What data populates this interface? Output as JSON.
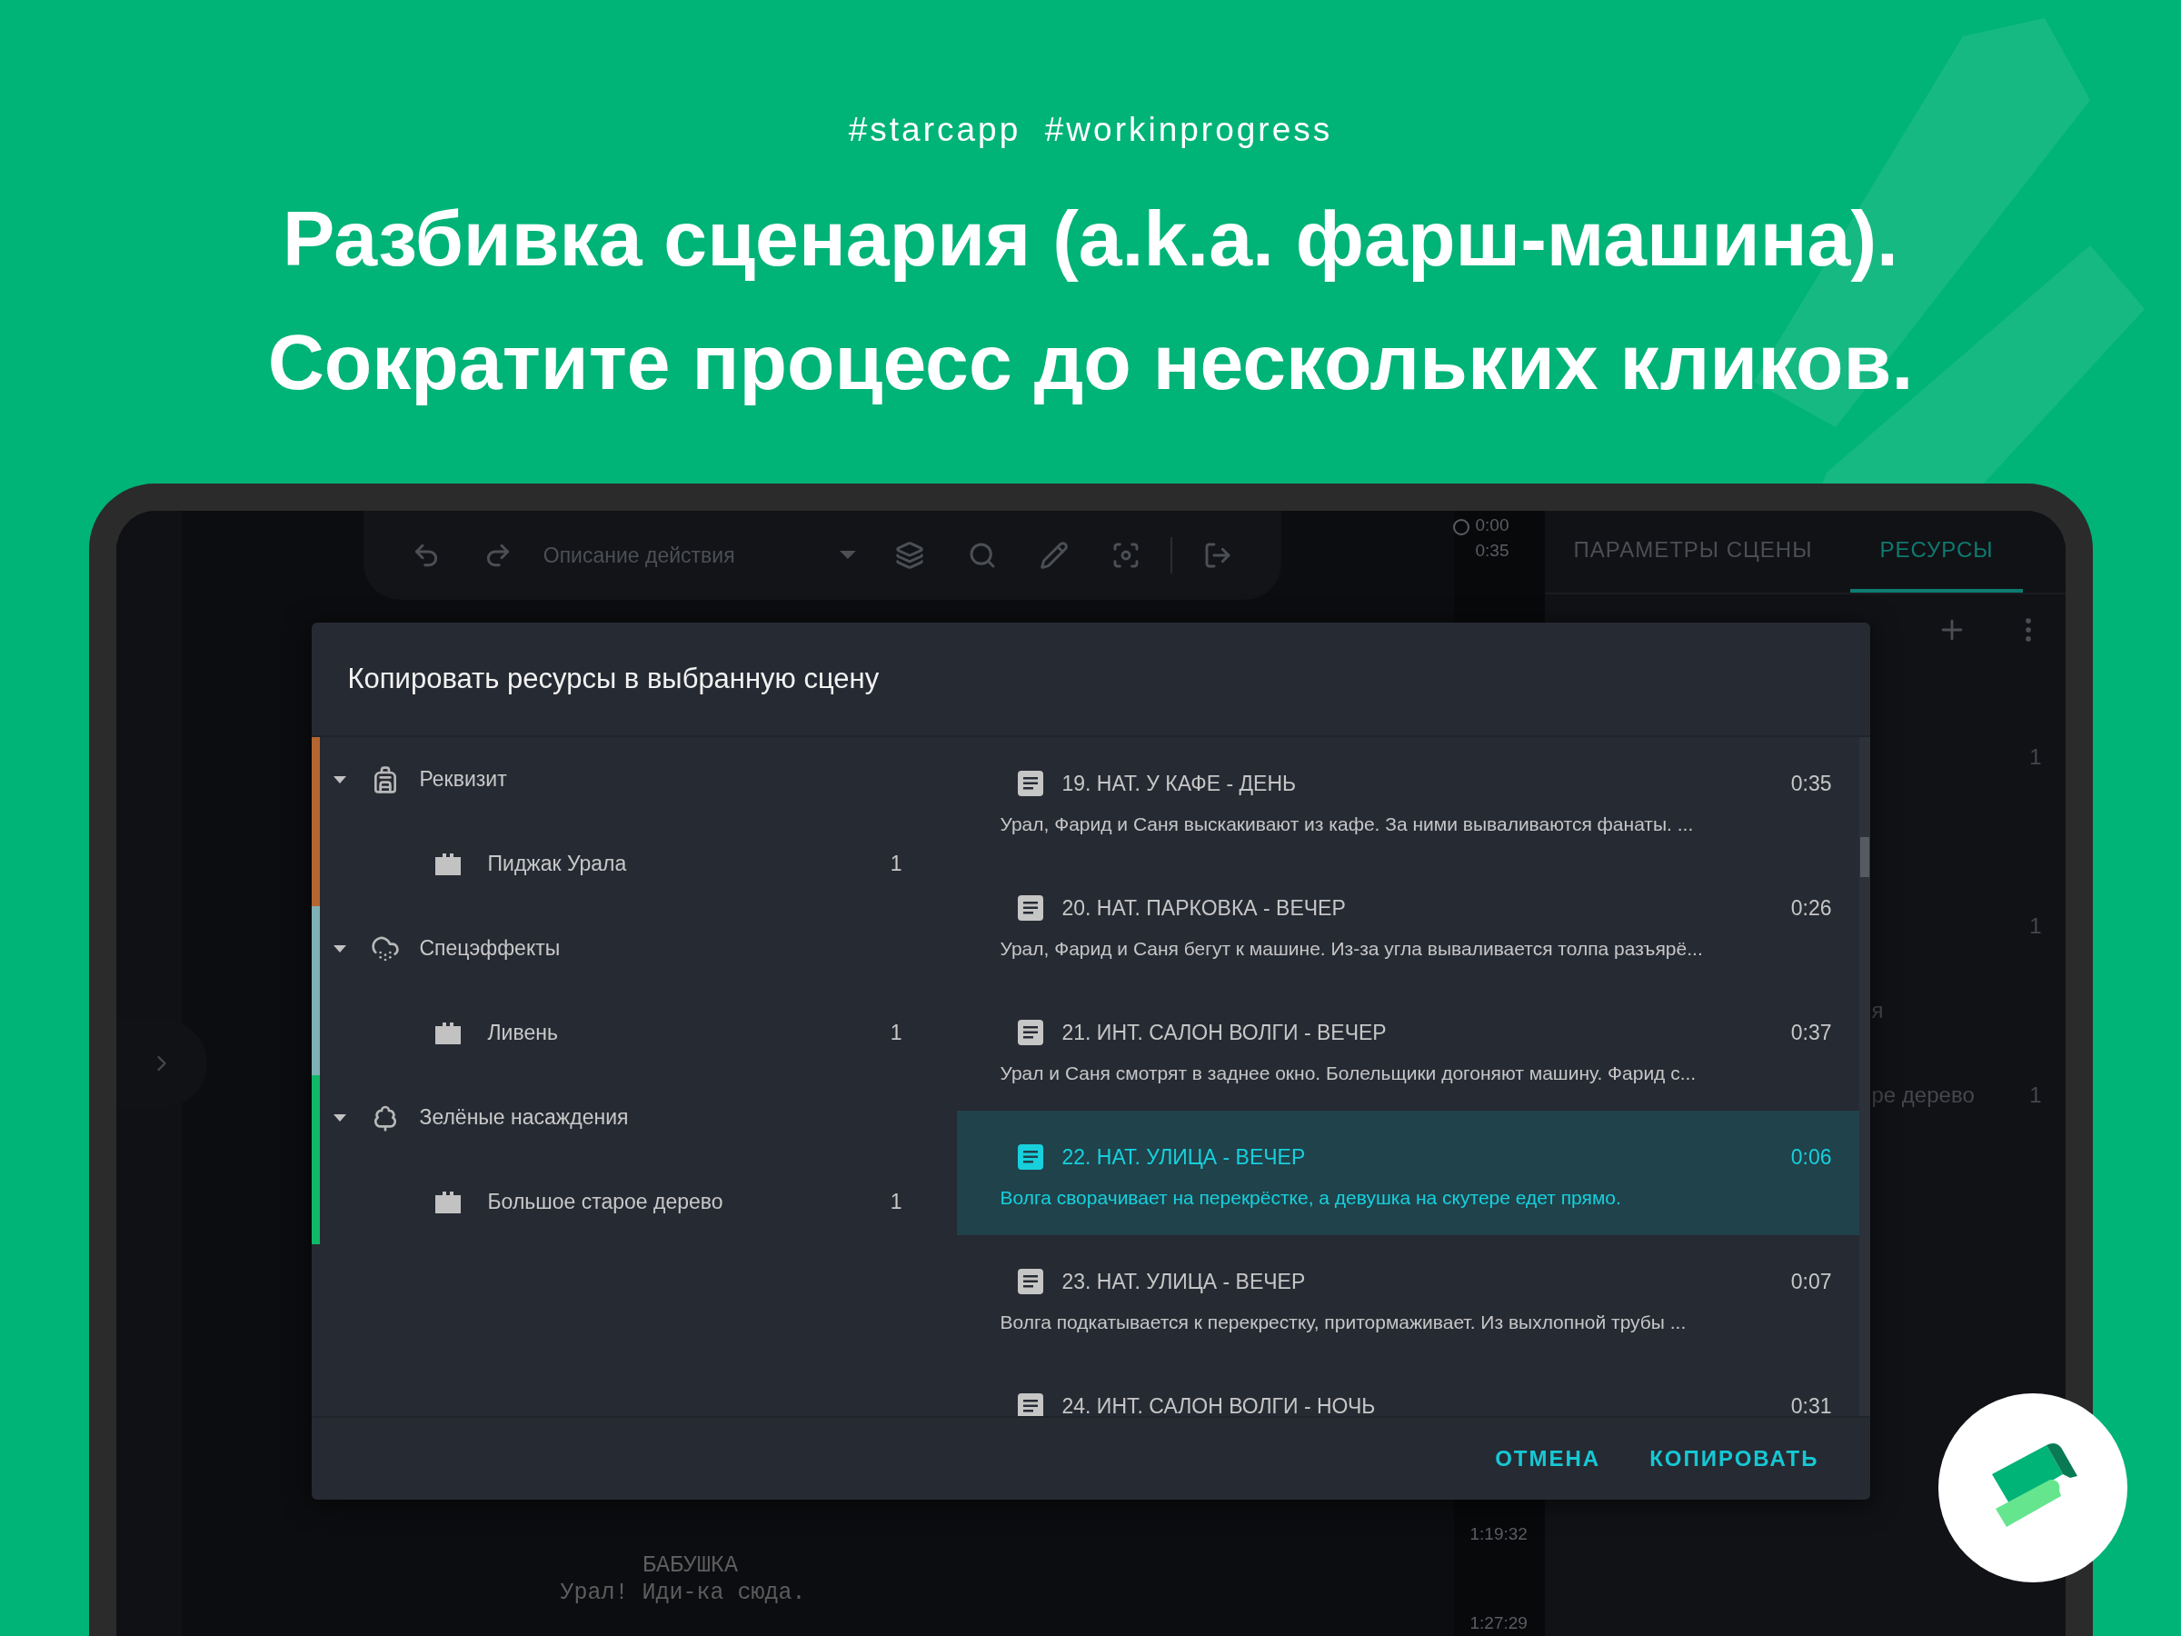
{
  "header": {
    "tags": "#starcapp  #workinprogress",
    "headline": [
      "Разбивка сценария (a.k.a. фарш-машина).",
      "Сократите процесс до нескольких кликов."
    ]
  },
  "editor": {
    "toolbar": {
      "block_type": "Описание действия"
    },
    "screenplay": [
      {
        "kind": "character",
        "text": "БАБУШКА"
      },
      {
        "kind": "dialogue",
        "text": "Урал! Иди-ка сюда."
      }
    ]
  },
  "timeline": {
    "top": [
      "0:00",
      "0:35"
    ],
    "bottom": [
      "1:19:32",
      "1:27:29"
    ]
  },
  "resources_panel": {
    "tabs": [
      {
        "label": "ПАРАМЕТРЫ СЦЕНЫ",
        "selected": false
      },
      {
        "label": "РЕСУРСЫ",
        "selected": true
      }
    ],
    "rows": [
      {
        "count": "1"
      },
      {},
      {
        "count": "1"
      },
      {
        "label": "я"
      },
      {
        "label": "ре дерево",
        "count": "1"
      }
    ]
  },
  "dialog": {
    "title": "Копировать ресурсы в выбранную сцену",
    "groups": [
      {
        "kind": "props",
        "label": "Реквизит",
        "color": "#b5652f",
        "expanded": true,
        "children": [
          {
            "label": "Пиджак Урала",
            "count": "1"
          }
        ]
      },
      {
        "kind": "effects",
        "label": "Спецэффекты",
        "color": "#7fb0b6",
        "expanded": true,
        "children": [
          {
            "label": "Ливень",
            "count": "1"
          }
        ]
      },
      {
        "kind": "plants",
        "label": "Зелёные насаждения",
        "color": "#10b866",
        "expanded": true,
        "children": [
          {
            "label": "Большое старое дерево",
            "count": "1"
          }
        ]
      }
    ],
    "scenes": [
      {
        "title": "19. НАТ. У КАФЕ - ДЕНЬ",
        "duration": "0:35",
        "description": "Урал, Фарид и Саня выскакивают из кафе. За ними вываливаются фанаты.  ...",
        "selected": false
      },
      {
        "title": "20. НАТ. ПАРКОВКА - ВЕЧЕР",
        "duration": "0:26",
        "description": "Урал, Фарид и Саня бегут к машине. Из-за угла вываливается толпа разъярё...",
        "selected": false
      },
      {
        "title": "21. ИНТ. САЛОН ВОЛГИ - ВЕЧЕР",
        "duration": "0:37",
        "description": "Урал и Саня смотрят в заднее окно. Болельщики догоняют машину. Фарид с...",
        "selected": false
      },
      {
        "title": "22. НАТ. УЛИЦА - ВЕЧЕР",
        "duration": "0:06",
        "description": "Волга сворачивает на перекрёстке, а девушка на скутере едет прямо.",
        "selected": true
      },
      {
        "title": "23. НАТ. УЛИЦА - ВЕЧЕР",
        "duration": "0:07",
        "description": "Волга подкатывается к перекрестку, притормаживает. Из выхлопной трубы ...",
        "selected": false
      },
      {
        "title": "24. ИНТ. САЛОН ВОЛГИ - НОЧЬ",
        "duration": "0:31",
        "selected": false
      }
    ],
    "buttons": [
      "ОТМЕНА",
      "КОПИРОВАТЬ"
    ]
  }
}
